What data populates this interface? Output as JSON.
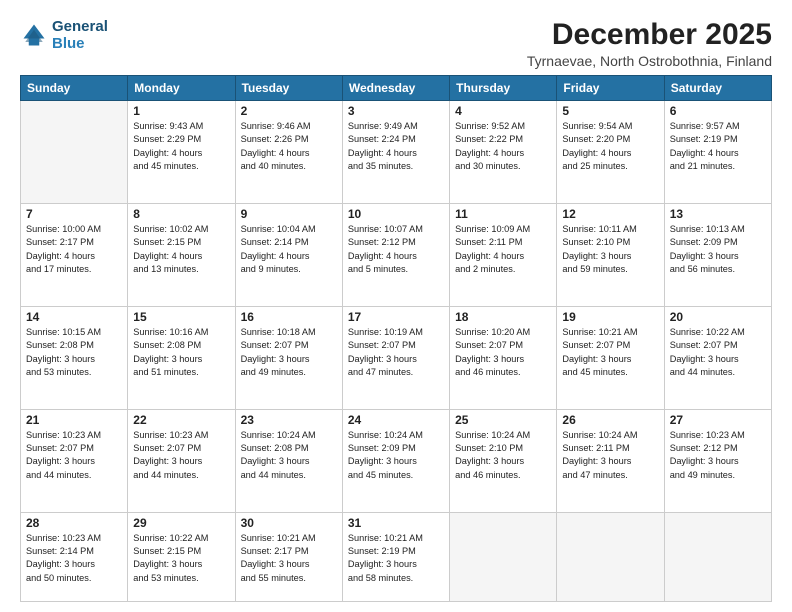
{
  "header": {
    "logo_line1": "General",
    "logo_line2": "Blue",
    "main_title": "December 2025",
    "subtitle": "Tyrnaevae, North Ostrobothnia, Finland"
  },
  "days_of_week": [
    "Sunday",
    "Monday",
    "Tuesday",
    "Wednesday",
    "Thursday",
    "Friday",
    "Saturday"
  ],
  "weeks": [
    [
      {
        "day": "",
        "info": ""
      },
      {
        "day": "1",
        "info": "Sunrise: 9:43 AM\nSunset: 2:29 PM\nDaylight: 4 hours\nand 45 minutes."
      },
      {
        "day": "2",
        "info": "Sunrise: 9:46 AM\nSunset: 2:26 PM\nDaylight: 4 hours\nand 40 minutes."
      },
      {
        "day": "3",
        "info": "Sunrise: 9:49 AM\nSunset: 2:24 PM\nDaylight: 4 hours\nand 35 minutes."
      },
      {
        "day": "4",
        "info": "Sunrise: 9:52 AM\nSunset: 2:22 PM\nDaylight: 4 hours\nand 30 minutes."
      },
      {
        "day": "5",
        "info": "Sunrise: 9:54 AM\nSunset: 2:20 PM\nDaylight: 4 hours\nand 25 minutes."
      },
      {
        "day": "6",
        "info": "Sunrise: 9:57 AM\nSunset: 2:19 PM\nDaylight: 4 hours\nand 21 minutes."
      }
    ],
    [
      {
        "day": "7",
        "info": "Sunrise: 10:00 AM\nSunset: 2:17 PM\nDaylight: 4 hours\nand 17 minutes."
      },
      {
        "day": "8",
        "info": "Sunrise: 10:02 AM\nSunset: 2:15 PM\nDaylight: 4 hours\nand 13 minutes."
      },
      {
        "day": "9",
        "info": "Sunrise: 10:04 AM\nSunset: 2:14 PM\nDaylight: 4 hours\nand 9 minutes."
      },
      {
        "day": "10",
        "info": "Sunrise: 10:07 AM\nSunset: 2:12 PM\nDaylight: 4 hours\nand 5 minutes."
      },
      {
        "day": "11",
        "info": "Sunrise: 10:09 AM\nSunset: 2:11 PM\nDaylight: 4 hours\nand 2 minutes."
      },
      {
        "day": "12",
        "info": "Sunrise: 10:11 AM\nSunset: 2:10 PM\nDaylight: 3 hours\nand 59 minutes."
      },
      {
        "day": "13",
        "info": "Sunrise: 10:13 AM\nSunset: 2:09 PM\nDaylight: 3 hours\nand 56 minutes."
      }
    ],
    [
      {
        "day": "14",
        "info": "Sunrise: 10:15 AM\nSunset: 2:08 PM\nDaylight: 3 hours\nand 53 minutes."
      },
      {
        "day": "15",
        "info": "Sunrise: 10:16 AM\nSunset: 2:08 PM\nDaylight: 3 hours\nand 51 minutes."
      },
      {
        "day": "16",
        "info": "Sunrise: 10:18 AM\nSunset: 2:07 PM\nDaylight: 3 hours\nand 49 minutes."
      },
      {
        "day": "17",
        "info": "Sunrise: 10:19 AM\nSunset: 2:07 PM\nDaylight: 3 hours\nand 47 minutes."
      },
      {
        "day": "18",
        "info": "Sunrise: 10:20 AM\nSunset: 2:07 PM\nDaylight: 3 hours\nand 46 minutes."
      },
      {
        "day": "19",
        "info": "Sunrise: 10:21 AM\nSunset: 2:07 PM\nDaylight: 3 hours\nand 45 minutes."
      },
      {
        "day": "20",
        "info": "Sunrise: 10:22 AM\nSunset: 2:07 PM\nDaylight: 3 hours\nand 44 minutes."
      }
    ],
    [
      {
        "day": "21",
        "info": "Sunrise: 10:23 AM\nSunset: 2:07 PM\nDaylight: 3 hours\nand 44 minutes."
      },
      {
        "day": "22",
        "info": "Sunrise: 10:23 AM\nSunset: 2:07 PM\nDaylight: 3 hours\nand 44 minutes."
      },
      {
        "day": "23",
        "info": "Sunrise: 10:24 AM\nSunset: 2:08 PM\nDaylight: 3 hours\nand 44 minutes."
      },
      {
        "day": "24",
        "info": "Sunrise: 10:24 AM\nSunset: 2:09 PM\nDaylight: 3 hours\nand 45 minutes."
      },
      {
        "day": "25",
        "info": "Sunrise: 10:24 AM\nSunset: 2:10 PM\nDaylight: 3 hours\nand 46 minutes."
      },
      {
        "day": "26",
        "info": "Sunrise: 10:24 AM\nSunset: 2:11 PM\nDaylight: 3 hours\nand 47 minutes."
      },
      {
        "day": "27",
        "info": "Sunrise: 10:23 AM\nSunset: 2:12 PM\nDaylight: 3 hours\nand 49 minutes."
      }
    ],
    [
      {
        "day": "28",
        "info": "Sunrise: 10:23 AM\nSunset: 2:14 PM\nDaylight: 3 hours\nand 50 minutes."
      },
      {
        "day": "29",
        "info": "Sunrise: 10:22 AM\nSunset: 2:15 PM\nDaylight: 3 hours\nand 53 minutes."
      },
      {
        "day": "30",
        "info": "Sunrise: 10:21 AM\nSunset: 2:17 PM\nDaylight: 3 hours\nand 55 minutes."
      },
      {
        "day": "31",
        "info": "Sunrise: 10:21 AM\nSunset: 2:19 PM\nDaylight: 3 hours\nand 58 minutes."
      },
      {
        "day": "",
        "info": ""
      },
      {
        "day": "",
        "info": ""
      },
      {
        "day": "",
        "info": ""
      }
    ]
  ]
}
